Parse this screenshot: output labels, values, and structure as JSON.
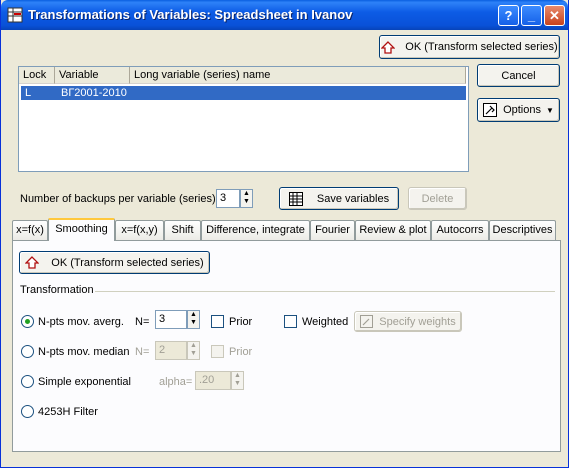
{
  "window": {
    "title": "Transformations of Variables: Spreadsheet in Ivanov"
  },
  "titlebar_buttons": {
    "help": "?",
    "minimize": "_",
    "close": "✕"
  },
  "top_ok_label": "OK (Transform selected series)",
  "cancel_label": "Cancel",
  "options_label": "Options",
  "variables_list": {
    "columns": [
      "Lock",
      "Variable",
      "Long variable (series) name"
    ],
    "rows": [
      {
        "lock": "L",
        "variable": "ВГ2001-2010",
        "long_name": ""
      }
    ]
  },
  "backups": {
    "label": "Number of backups per variable (series):",
    "value": "3"
  },
  "save_variables_label": "Save variables",
  "delete_label": "Delete",
  "tabs": [
    "x=f(x)",
    "Smoothing",
    "x=f(x,y)",
    "Shift",
    "Difference, integrate",
    "Fourier",
    "Review & plot",
    "Autocorrs",
    "Descriptives"
  ],
  "active_tab": "Smoothing",
  "panel_ok_label": "OK (Transform selected series)",
  "transformation_group": "Transformation",
  "options": {
    "npts_avg": {
      "label": "N-pts mov. averg.",
      "n_label": "N=",
      "n_value": "3",
      "selected": true
    },
    "prior_label": "Prior",
    "weighted_label": "Weighted",
    "specify_weights_label": "Specify weights",
    "npts_median": {
      "label": "N-pts mov. median",
      "n_label": "N=",
      "n_value": "2"
    },
    "prior2_label": "Prior",
    "simple_exp": {
      "label": "Simple exponential",
      "alpha_label": "alpha=",
      "alpha_value": ".20"
    },
    "filter_label": "4253H Filter"
  },
  "colors": {
    "titlebar": "#0a5fe0",
    "selection": "#316ac5",
    "tab_highlight": "#ffc83c"
  }
}
